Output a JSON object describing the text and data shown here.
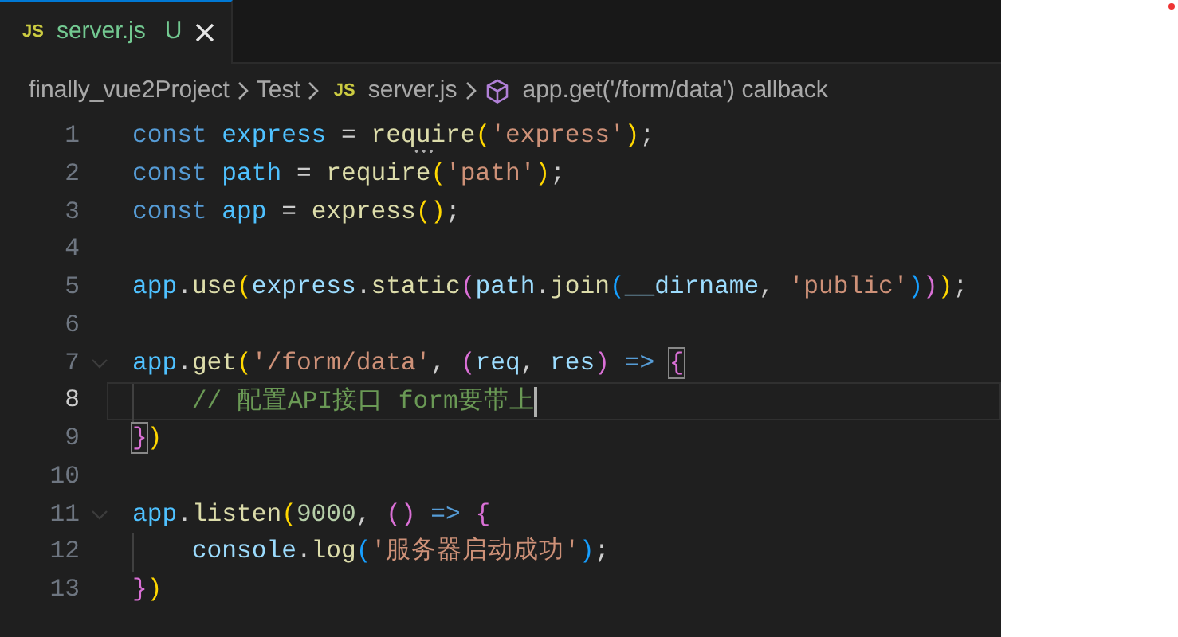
{
  "tabs": [
    {
      "icon_label": "JS",
      "label": "server.js",
      "status": "U",
      "selected": true
    }
  ],
  "breadcrumbs": [
    {
      "kind": "folder",
      "text": "finally_vue2Project"
    },
    {
      "kind": "folder",
      "text": "Test"
    },
    {
      "kind": "file",
      "icon_label": "JS",
      "text": "server.js"
    },
    {
      "kind": "symbol",
      "text": "app.get('/form/data') callback"
    }
  ],
  "lines": [
    {
      "number": "1",
      "current": false,
      "foldable": false,
      "indented": false,
      "tokens": [
        {
          "kind": "keyword",
          "text": "const "
        },
        {
          "kind": "constant",
          "text": "express"
        },
        {
          "kind": "plain",
          "text": " = "
        },
        {
          "kind": "function-hint",
          "text": "require"
        },
        {
          "kind": "bracket1",
          "text": "("
        },
        {
          "kind": "string",
          "text": "'express'"
        },
        {
          "kind": "bracket1",
          "text": ")"
        },
        {
          "kind": "plain",
          "text": ";"
        }
      ]
    },
    {
      "number": "2",
      "current": false,
      "foldable": false,
      "indented": false,
      "tokens": [
        {
          "kind": "keyword",
          "text": "const "
        },
        {
          "kind": "constant",
          "text": "path"
        },
        {
          "kind": "plain",
          "text": " = "
        },
        {
          "kind": "function",
          "text": "require"
        },
        {
          "kind": "bracket1",
          "text": "("
        },
        {
          "kind": "string",
          "text": "'path'"
        },
        {
          "kind": "bracket1",
          "text": ")"
        },
        {
          "kind": "plain",
          "text": ";"
        }
      ]
    },
    {
      "number": "3",
      "current": false,
      "foldable": false,
      "indented": false,
      "tokens": [
        {
          "kind": "keyword",
          "text": "const "
        },
        {
          "kind": "constant",
          "text": "app"
        },
        {
          "kind": "plain",
          "text": " = "
        },
        {
          "kind": "function",
          "text": "express"
        },
        {
          "kind": "bracket1",
          "text": "()"
        },
        {
          "kind": "plain",
          "text": ";"
        }
      ]
    },
    {
      "number": "4",
      "current": false,
      "foldable": false,
      "indented": false
    },
    {
      "number": "5",
      "current": false,
      "foldable": false,
      "indented": false,
      "tokens": [
        {
          "kind": "constant",
          "text": "app"
        },
        {
          "kind": "plain",
          "text": "."
        },
        {
          "kind": "function",
          "text": "use"
        },
        {
          "kind": "bracket1",
          "text": "("
        },
        {
          "kind": "variable",
          "text": "express"
        },
        {
          "kind": "plain",
          "text": "."
        },
        {
          "kind": "function",
          "text": "static"
        },
        {
          "kind": "bracket2",
          "text": "("
        },
        {
          "kind": "variable",
          "text": "path"
        },
        {
          "kind": "plain",
          "text": "."
        },
        {
          "kind": "function",
          "text": "join"
        },
        {
          "kind": "bracket3",
          "text": "("
        },
        {
          "kind": "variable",
          "text": "__dirname"
        },
        {
          "kind": "plain",
          "text": ", "
        },
        {
          "kind": "string",
          "text": "'public'"
        },
        {
          "kind": "bracket3",
          "text": ")"
        },
        {
          "kind": "bracket2",
          "text": ")"
        },
        {
          "kind": "bracket1",
          "text": ")"
        },
        {
          "kind": "plain",
          "text": ";"
        }
      ]
    },
    {
      "number": "6",
      "current": false,
      "foldable": false,
      "indented": false
    },
    {
      "number": "7",
      "current": false,
      "foldable": true,
      "indented": false,
      "tokens": [
        {
          "kind": "constant",
          "text": "app"
        },
        {
          "kind": "plain",
          "text": "."
        },
        {
          "kind": "function",
          "text": "get"
        },
        {
          "kind": "bracket1",
          "text": "("
        },
        {
          "kind": "string",
          "text": "'/form/data'"
        },
        {
          "kind": "plain",
          "text": ", "
        },
        {
          "kind": "bracket2",
          "text": "("
        },
        {
          "kind": "variable",
          "text": "req"
        },
        {
          "kind": "plain",
          "text": ", "
        },
        {
          "kind": "variable",
          "text": "res"
        },
        {
          "kind": "bracket2",
          "text": ")"
        },
        {
          "kind": "keyword",
          "text": " => "
        },
        {
          "kind": "matched-bracket",
          "text": "{"
        }
      ]
    },
    {
      "number": "8",
      "current": true,
      "foldable": false,
      "indented": true,
      "tokens": [
        {
          "kind": "comment",
          "text": "// 配置API接口 form要带上"
        }
      ]
    },
    {
      "number": "9",
      "current": false,
      "foldable": false,
      "indented": false,
      "tokens": [
        {
          "kind": "matched-bracket",
          "text": "}"
        },
        {
          "kind": "bracket1",
          "text": ")"
        }
      ]
    },
    {
      "number": "10",
      "current": false,
      "foldable": false,
      "indented": false
    },
    {
      "number": "11",
      "current": false,
      "foldable": true,
      "indented": false,
      "tokens": [
        {
          "kind": "constant",
          "text": "app"
        },
        {
          "kind": "plain",
          "text": "."
        },
        {
          "kind": "function",
          "text": "listen"
        },
        {
          "kind": "bracket1",
          "text": "("
        },
        {
          "kind": "number",
          "text": "9000"
        },
        {
          "kind": "plain",
          "text": ", "
        },
        {
          "kind": "bracket2",
          "text": "()"
        },
        {
          "kind": "keyword",
          "text": " => "
        },
        {
          "kind": "bracket2",
          "text": "{"
        }
      ]
    },
    {
      "number": "12",
      "current": false,
      "foldable": false,
      "indented": true,
      "tokens": [
        {
          "kind": "variable",
          "text": "console"
        },
        {
          "kind": "plain",
          "text": "."
        },
        {
          "kind": "function",
          "text": "log"
        },
        {
          "kind": "bracket3",
          "text": "("
        },
        {
          "kind": "string",
          "text": "'服务器启动成功'"
        },
        {
          "kind": "bracket3",
          "text": ")"
        },
        {
          "kind": "plain",
          "text": ";"
        }
      ]
    },
    {
      "number": "13",
      "current": false,
      "foldable": false,
      "indented": false,
      "tokens": [
        {
          "kind": "bracket2",
          "text": "}"
        },
        {
          "kind": "bracket1",
          "text": ")"
        }
      ]
    }
  ]
}
